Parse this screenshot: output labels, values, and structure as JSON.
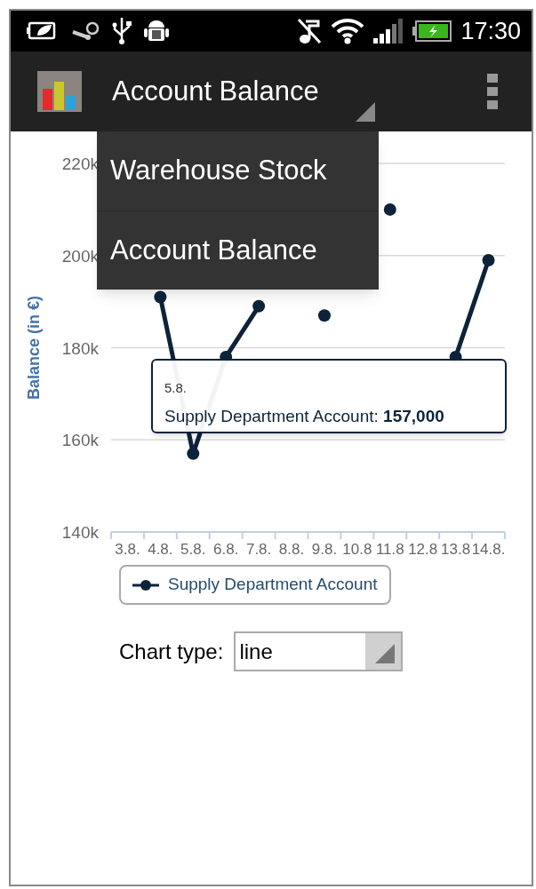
{
  "status_bar": {
    "time": "17:30"
  },
  "action_bar": {
    "title": "Account Balance"
  },
  "dropdown_menu": {
    "items": [
      {
        "label": "Warehouse Stock"
      },
      {
        "label": "Account Balance"
      }
    ]
  },
  "chart": {
    "chart_data": {
      "type": "line",
      "ylabel": "Balance (in €)",
      "categories": [
        "3.8.",
        "4.8.",
        "5.8.",
        "6.8.",
        "7.8.",
        "8.8.",
        "9.8.",
        "10.8",
        "11.8",
        "12.8",
        "13.8",
        "14.8."
      ],
      "series": [
        {
          "name": "Supply Department Account",
          "color": "#0d233a",
          "marker": true,
          "values": [
            null,
            191000,
            157000,
            178000,
            189000,
            null,
            187000,
            null,
            210000,
            null,
            178000,
            199000
          ]
        }
      ],
      "grid": true,
      "ylim": [
        140000,
        220000
      ],
      "yticks": [
        {
          "value": 140000,
          "label": "140k"
        },
        {
          "value": 160000,
          "label": "160k"
        },
        {
          "value": 180000,
          "label": "180k"
        },
        {
          "value": 200000,
          "label": "200k"
        },
        {
          "value": 220000,
          "label": "220k"
        }
      ]
    },
    "tooltip": {
      "category": "5.8.",
      "text": "Supply Department Account: **157,000**"
    }
  },
  "chart_type": {
    "label": "Chart type:",
    "value": "line"
  }
}
